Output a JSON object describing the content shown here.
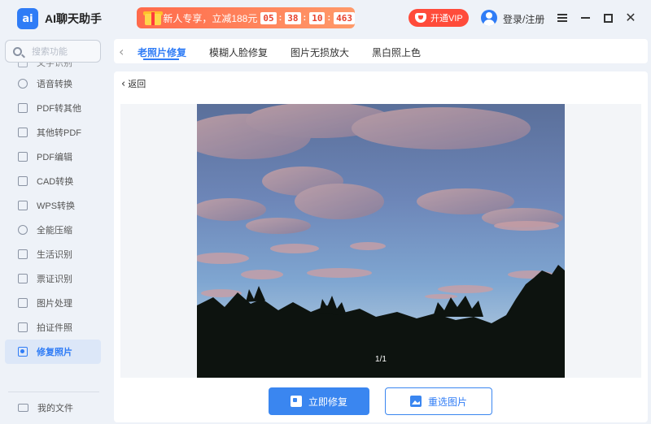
{
  "app": {
    "logo_text": "ai",
    "title": "AI聊天助手"
  },
  "promo": {
    "text": "新人专享，立减188元",
    "countdown": [
      "05",
      "38",
      "10",
      "463"
    ]
  },
  "header": {
    "vip_label": "开通VIP",
    "login_label": "登录/注册"
  },
  "sidebar": {
    "search_placeholder": "搜索功能",
    "partial_item": "文字识别",
    "items": [
      {
        "label": "语音转换",
        "icon": "audio-icon"
      },
      {
        "label": "PDF转其他",
        "icon": "pdf-convert-icon"
      },
      {
        "label": "其他转PDF",
        "icon": "to-pdf-icon"
      },
      {
        "label": "PDF编辑",
        "icon": "pdf-edit-icon"
      },
      {
        "label": "CAD转换",
        "icon": "cad-icon"
      },
      {
        "label": "WPS转换",
        "icon": "wps-icon"
      },
      {
        "label": "全能压缩",
        "icon": "compress-icon"
      },
      {
        "label": "生活识别",
        "icon": "scan-icon"
      },
      {
        "label": "票证识别",
        "icon": "ticket-icon"
      },
      {
        "label": "图片处理",
        "icon": "image-icon"
      },
      {
        "label": "拍证件照",
        "icon": "id-photo-icon"
      },
      {
        "label": "修复照片",
        "icon": "camera-icon",
        "active": true
      }
    ],
    "my_files": "我的文件"
  },
  "tabs": [
    {
      "label": "老照片修复",
      "active": true
    },
    {
      "label": "模糊人脸修复",
      "active": false
    },
    {
      "label": "图片无损放大",
      "active": false
    },
    {
      "label": "黑白照上色",
      "active": false
    }
  ],
  "content": {
    "back_label": "返回",
    "page_indicator": "1/1",
    "primary_button": "立即修复",
    "secondary_button": "重选图片"
  },
  "colors": {
    "accent": "#2f7cf6",
    "promo": "#ff6a4b",
    "vip": "#ff4b3a"
  }
}
